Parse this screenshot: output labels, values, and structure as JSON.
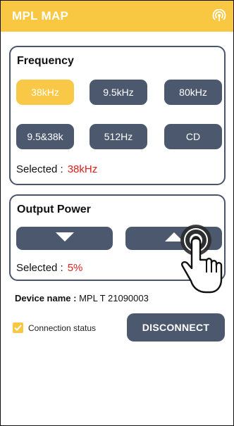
{
  "appbar": {
    "title": "MPL MAP",
    "icon": "broadcast-icon"
  },
  "frequency": {
    "title": "Frequency",
    "buttons": [
      "38kHz",
      "9.5kHz",
      "80kHz",
      "9.5&38k",
      "512Hz",
      "CD"
    ],
    "active": "38kHz",
    "selected_label": "Selected :",
    "selected_value": "38kHz"
  },
  "power": {
    "title": "Output Power",
    "down_icon": "down-arrow-icon",
    "up_icon": "up-arrow-icon",
    "selected_label": "Selected :",
    "selected_value": "5%"
  },
  "device": {
    "label": "Device name :",
    "value": "MPL T 21090003"
  },
  "connection": {
    "label": "Connection status",
    "checked": true
  },
  "disconnect_label": "DISCONNECT",
  "colors": {
    "accent": "#f8c842",
    "button": "#4b586e",
    "value_red": "#e01c1c"
  }
}
